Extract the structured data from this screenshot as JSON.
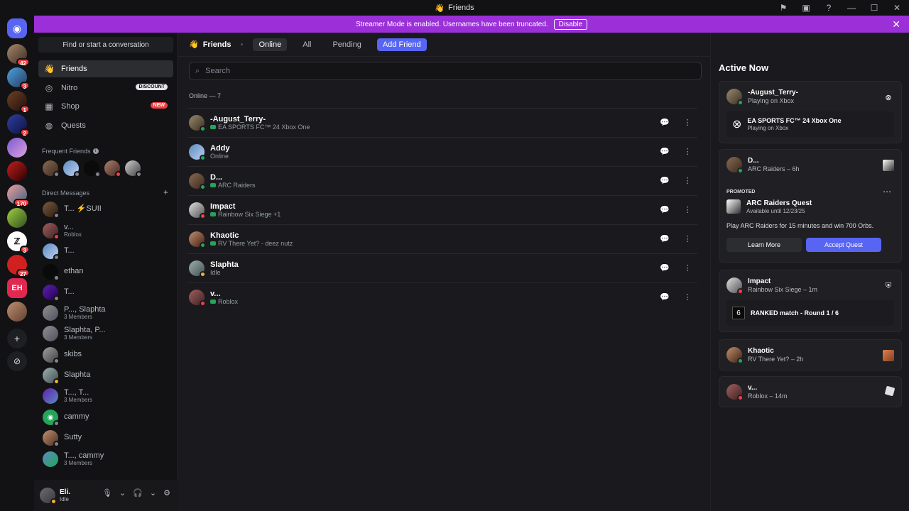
{
  "window": {
    "title": "Friends"
  },
  "banner": {
    "text": "Streamer Mode is enabled. Usernames have been truncated.",
    "disable_label": "Disable"
  },
  "rail": {
    "badges": [
      "42",
      "3",
      "1",
      "2",
      "170",
      "3",
      "27"
    ]
  },
  "sidebar": {
    "find_label": "Find or start a conversation",
    "nav": [
      {
        "label": "Friends",
        "icon": "friends-icon"
      },
      {
        "label": "Nitro",
        "icon": "nitro-icon",
        "tag": "DISCOUNT"
      },
      {
        "label": "Shop",
        "icon": "shop-icon",
        "tag": "NEW"
      },
      {
        "label": "Quests",
        "icon": "quests-icon"
      }
    ],
    "frequent_label": "Frequent Friends",
    "dm_label": "Direct Messages",
    "dms": [
      {
        "name": "T... ⚡SUII",
        "sub": ""
      },
      {
        "name": "v...",
        "sub": "Roblox"
      },
      {
        "name": "T...",
        "sub": ""
      },
      {
        "name": "ethan",
        "sub": ""
      },
      {
        "name": "T...",
        "sub": ""
      },
      {
        "name": "P..., Slaphta",
        "sub": "3 Members"
      },
      {
        "name": "Slaphta, P...",
        "sub": "3 Members"
      },
      {
        "name": "skibs",
        "sub": ""
      },
      {
        "name": "Slaphta",
        "sub": ""
      },
      {
        "name": "T..., T...",
        "sub": "3 Members"
      },
      {
        "name": "cammy",
        "sub": ""
      },
      {
        "name": "Sutty",
        "sub": ""
      },
      {
        "name": "T..., cammy",
        "sub": "3 Members"
      }
    ]
  },
  "user": {
    "name": "Eli.",
    "status": "Idle"
  },
  "topnav": {
    "title": "Friends",
    "tabs": [
      "Online",
      "All",
      "Pending"
    ],
    "add_label": "Add Friend"
  },
  "search": {
    "placeholder": "Search"
  },
  "online_count": "Online — 7",
  "friends": [
    {
      "name": "-August_Terry-",
      "status": "EA SPORTS FC™ 24 Xbox One",
      "game": true,
      "presence": "on"
    },
    {
      "name": "Addy",
      "status": "Online",
      "game": false,
      "presence": "on"
    },
    {
      "name": "D...",
      "status": "ARC Raiders",
      "game": true,
      "presence": "on"
    },
    {
      "name": "Impact",
      "status": "Rainbow Six Siege +1",
      "game": true,
      "presence": "dnd"
    },
    {
      "name": "Khaotic",
      "status": "RV There Yet? - deez nutz",
      "game": true,
      "presence": "on"
    },
    {
      "name": "Slaphta",
      "status": "Idle",
      "game": false,
      "presence": "idle"
    },
    {
      "name": "v...",
      "status": "Roblox",
      "game": true,
      "presence": "dnd"
    }
  ],
  "active_now": {
    "title": "Active Now",
    "cards": [
      {
        "name": "-August_Terry-",
        "status": "Playing on Xbox",
        "inner_title": "EA SPORTS FC™ 24 Xbox One",
        "inner_sub": "Playing on Xbox"
      },
      {
        "name": "D...",
        "status": "ARC Raiders – 6h",
        "promo_label": "PROMOTED",
        "quest_title": "ARC Raiders Quest",
        "quest_sub": "Available until 12/23/25",
        "quest_desc": "Play ARC Raiders for 15 minutes and win 700 Orbs.",
        "learn_label": "Learn More",
        "accept_label": "Accept Quest"
      },
      {
        "name": "Impact",
        "status": "Rainbow Six Siege – 1m",
        "inner_title": "RANKED match - Round 1 / 6"
      },
      {
        "name": "Khaotic",
        "status": "RV There Yet? – 2h"
      },
      {
        "name": "v...",
        "status": "Roblox – 14m"
      }
    ]
  },
  "colors": {
    "accent": "#5865f2",
    "banner": "#9b30d8",
    "online": "#23a55a",
    "idle": "#f0b232",
    "dnd": "#f23f43"
  }
}
